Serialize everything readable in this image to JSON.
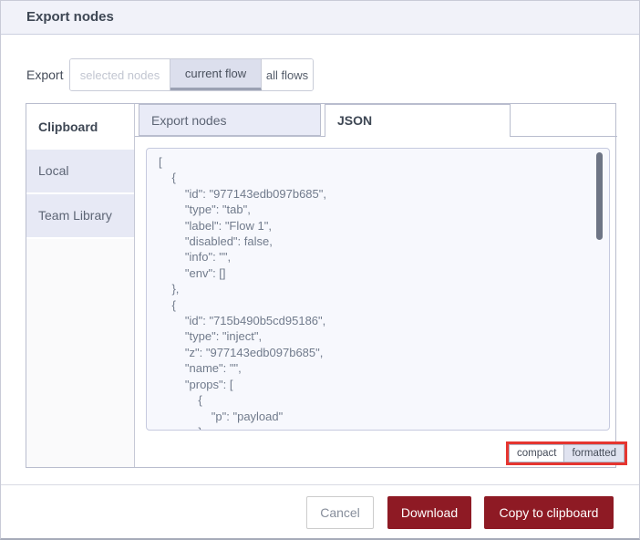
{
  "dialog": {
    "title": "Export nodes"
  },
  "export_row": {
    "label": "Export",
    "options": [
      {
        "label": "selected nodes",
        "state": "disabled"
      },
      {
        "label": "current flow",
        "state": "selected"
      },
      {
        "label": "all flows",
        "state": "default"
      }
    ]
  },
  "library": {
    "header": "Clipboard",
    "items": [
      {
        "label": "Local"
      },
      {
        "label": "Team Library"
      }
    ]
  },
  "tabs": [
    {
      "label": "Export nodes",
      "active": false
    },
    {
      "label": "JSON",
      "active": true
    }
  ],
  "json_view": {
    "content": "[\n    {\n        \"id\": \"977143edb097b685\",\n        \"type\": \"tab\",\n        \"label\": \"Flow 1\",\n        \"disabled\": false,\n        \"info\": \"\",\n        \"env\": []\n    },\n    {\n        \"id\": \"715b490b5cd95186\",\n        \"type\": \"inject\",\n        \"z\": \"977143edb097b685\",\n        \"name\": \"\",\n        \"props\": [\n            {\n                \"p\": \"payload\"\n            },",
    "format_toggle": [
      {
        "label": "compact",
        "selected": false
      },
      {
        "label": "formatted",
        "selected": true
      }
    ]
  },
  "footer": {
    "cancel_label": "Cancel",
    "download_label": "Download",
    "copy_label": "Copy to clipboard"
  },
  "colors": {
    "accent_red": "#8e1a24",
    "highlight_red": "#e53530",
    "lavender": "#e7e9f5",
    "header_bg": "#f1f2f9",
    "json_text": "#717b8c"
  }
}
